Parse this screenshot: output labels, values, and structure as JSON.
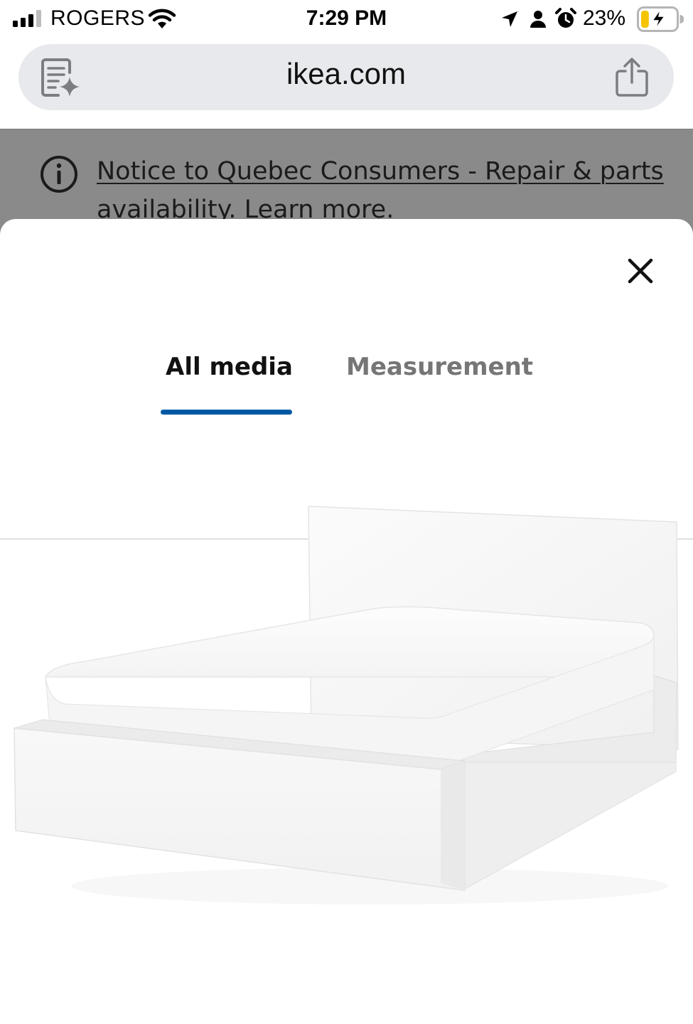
{
  "status_bar": {
    "carrier": "ROGERS",
    "time": "7:29 PM",
    "battery_percent": "23%",
    "battery_level": 0.23,
    "charging": true,
    "battery_fill_color": "#f5c400"
  },
  "browser": {
    "url": "ikea.com",
    "address_bar_color": "#e8e9ed"
  },
  "background_page": {
    "notice_text": "Notice to Quebec Consumers - Repair & parts availability. Learn more."
  },
  "modal": {
    "tabs": [
      {
        "label": "All media",
        "selected": true
      },
      {
        "label": "Measurement",
        "selected": false
      }
    ],
    "accent_color": "#0058a3",
    "image_subject": "white bed frame with mattress"
  },
  "icons": {
    "signal": "cellular-signal-icon",
    "wifi": "wifi-icon",
    "location": "location-arrow-icon",
    "person": "person-icon",
    "alarm": "alarm-clock-icon",
    "battery": "battery-charging-icon",
    "reader": "reader-mode-icon",
    "share": "share-icon",
    "info": "info-icon",
    "close": "close-icon"
  }
}
